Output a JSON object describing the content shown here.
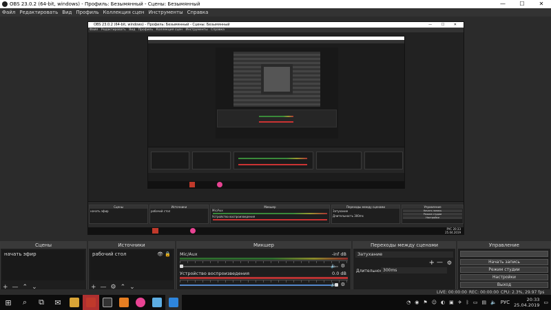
{
  "window": {
    "title": "OBS 23.0.2 (64-bit, windows) - Профиль: Безымянный - Сцены: Безымянный"
  },
  "window_controls": {
    "minimize": "—",
    "maximize": "☐",
    "close": "✕"
  },
  "menu": [
    "Файл",
    "Редактировать",
    "Вид",
    "Профиль",
    "Коллекция сцен",
    "Инструменты",
    "Справка"
  ],
  "nested_window": {
    "title": "OBS 23.0.2 (64-bit, windows) - Профиль: Безымянный - Сцены: Безымянный",
    "menu": [
      "Файл",
      "Редактировать",
      "Вид",
      "Профиль",
      "Коллекция сцен",
      "Инструменты",
      "Справка"
    ],
    "panels": {
      "scenes": "Сцены",
      "sources": "Источники",
      "mixer": "Микшер",
      "transitions": "Переходы между сценами",
      "controls": "Управление"
    },
    "scene_item": "начать эфир",
    "source_item": "рабочий стол",
    "mic_label": "Mic/Aux",
    "desktop_label": "Устройство воспроизведения",
    "transition": "Затухание",
    "duration_label": "Длительность",
    "duration": "300ms",
    "buttons": [
      "Начать запись",
      "Режим студии",
      "Настройки",
      "Выход"
    ],
    "status": {
      "live": "LIVE: 00:00:00",
      "rec": "REC: 00:00:00",
      "cpu": "CPU: 2.3%, 29.97 fps"
    },
    "clock_time": "20:33",
    "clock_date": "25.04.2019",
    "lang": "РУС"
  },
  "scenes": {
    "header": "Сцены",
    "items": [
      "начать эфир"
    ]
  },
  "sources": {
    "header": "Источники",
    "items": [
      "рабочий стол"
    ]
  },
  "mixer": {
    "header": "Микшер",
    "channels": [
      {
        "name": "Mic/Aux",
        "db": "-inf dB",
        "volume": 0.0
      },
      {
        "name": "Устройство воспроизведения",
        "db": "0.0 dB",
        "volume": 1.0
      }
    ]
  },
  "transitions": {
    "header": "Переходы между сценами",
    "selected": "Затухание",
    "duration_label": "Длительность",
    "duration": "300ms"
  },
  "controls": {
    "header": "Управление",
    "buttons": [
      "Начать запись",
      "Режим студии",
      "Настройки",
      "Выход"
    ]
  },
  "status": {
    "live": "LIVE: 00:00:00",
    "rec": "REC: 00:00:00",
    "cpu": "CPU: 2.3%, 29.97 fps"
  },
  "taskbar": {
    "lang": "РУС",
    "time": "20:33",
    "date": "25.04.2019"
  },
  "colors": {
    "accent_red": "#c0392b",
    "meter_green": "#2e6b2e",
    "meter_red": "#b33333",
    "slider_blue": "#5588cc"
  }
}
